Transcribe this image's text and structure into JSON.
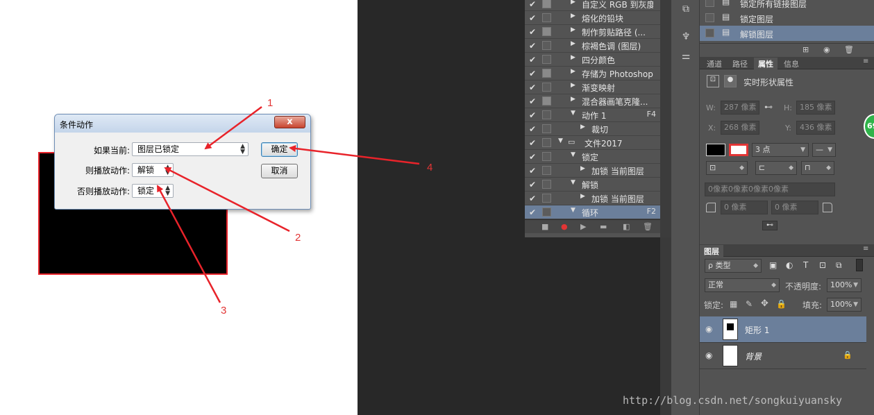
{
  "dialog": {
    "title": "条件动作",
    "close_label": "x",
    "if_label": "如果当前:",
    "if_value": "图层已锁定",
    "then_label": "则播放动作:",
    "then_value": "解锁",
    "else_label": "否则播放动作:",
    "else_value": "锁定",
    "ok_label": "确定",
    "cancel_label": "取消"
  },
  "annotations": [
    "1",
    "2",
    "3",
    "4"
  ],
  "actions": [
    {
      "checked": true,
      "dialog": true,
      "indent": 0,
      "tri": "▶",
      "label": "自定义 RGB 到灰度",
      "key": ""
    },
    {
      "checked": true,
      "dialog": false,
      "indent": 0,
      "tri": "▶",
      "label": "熔化的铅块",
      "key": ""
    },
    {
      "checked": true,
      "dialog": true,
      "indent": 0,
      "tri": "▶",
      "label": "制作剪贴路径 (...",
      "key": ""
    },
    {
      "checked": true,
      "dialog": false,
      "indent": 0,
      "tri": "▶",
      "label": "棕褐色调 (图层)",
      "key": ""
    },
    {
      "checked": true,
      "dialog": false,
      "indent": 0,
      "tri": "▶",
      "label": "四分颜色",
      "key": ""
    },
    {
      "checked": true,
      "dialog": true,
      "indent": 0,
      "tri": "▶",
      "label": "存储为 Photoshop...",
      "key": ""
    },
    {
      "checked": true,
      "dialog": false,
      "indent": 0,
      "tri": "▶",
      "label": "渐变映射",
      "key": ""
    },
    {
      "checked": true,
      "dialog": true,
      "indent": 0,
      "tri": "▶",
      "label": "混合器画笔克隆...",
      "key": ""
    },
    {
      "checked": true,
      "dialog": false,
      "indent": 0,
      "tri": "▼",
      "label": "动作 1",
      "key": "F4"
    },
    {
      "checked": true,
      "dialog": false,
      "indent": 1,
      "tri": "▶",
      "label": "裁切",
      "key": ""
    },
    {
      "checked": true,
      "dialog": false,
      "indent": -1,
      "tri": "▼",
      "label": "文件2017",
      "key": ""
    },
    {
      "checked": true,
      "dialog": false,
      "indent": 0,
      "tri": "▼",
      "label": "锁定",
      "key": ""
    },
    {
      "checked": true,
      "dialog": false,
      "indent": 1,
      "tri": "▶",
      "label": "加锁 当前图层",
      "key": ""
    },
    {
      "checked": true,
      "dialog": false,
      "indent": 0,
      "tri": "▼",
      "label": "解锁",
      "key": ""
    },
    {
      "checked": true,
      "dialog": false,
      "indent": 1,
      "tri": "▶",
      "label": "加锁 当前图层",
      "key": ""
    },
    {
      "checked": false,
      "dialog": false,
      "indent": 0,
      "tri": "▼",
      "label": "循环",
      "key": "F2",
      "selected": true
    }
  ],
  "top_right_rows": [
    {
      "label": "锁定所有链接图层",
      "selected": false
    },
    {
      "label": "锁定图层",
      "selected": false
    },
    {
      "label": "解锁图层",
      "selected": true
    }
  ],
  "props_tabs": [
    "通道",
    "路径",
    "属性",
    "信息"
  ],
  "props": {
    "title": "实时形状属性",
    "w_label": "W:",
    "w_value": "287 像素",
    "h_label": "H:",
    "h_value": "185 像素",
    "x_label": "X:",
    "x_value": "268 像素",
    "y_label": "Y:",
    "y_value": "436 像素",
    "stroke_size": "3 点",
    "corner_all": "0像素0像素0像素0像素",
    "corner_a": "0 像素",
    "corner_b": "0 像素"
  },
  "layers": {
    "tab": "图层",
    "filter_label": "ρ 类型",
    "blend_mode": "正常",
    "opacity_label": "不透明度:",
    "opacity_value": "100%",
    "lock_label": "锁定:",
    "fill_label": "填充:",
    "fill_value": "100%",
    "items": [
      {
        "name": "矩形 1",
        "selected": true
      },
      {
        "name": "背景",
        "selected": false
      }
    ]
  },
  "badge": "69",
  "watermark": "http://blog.csdn.net/songkuiyuansky",
  "colors": {
    "accent": "#e8232a",
    "selected_row": "#6b7f9b",
    "panel": "#535353"
  }
}
